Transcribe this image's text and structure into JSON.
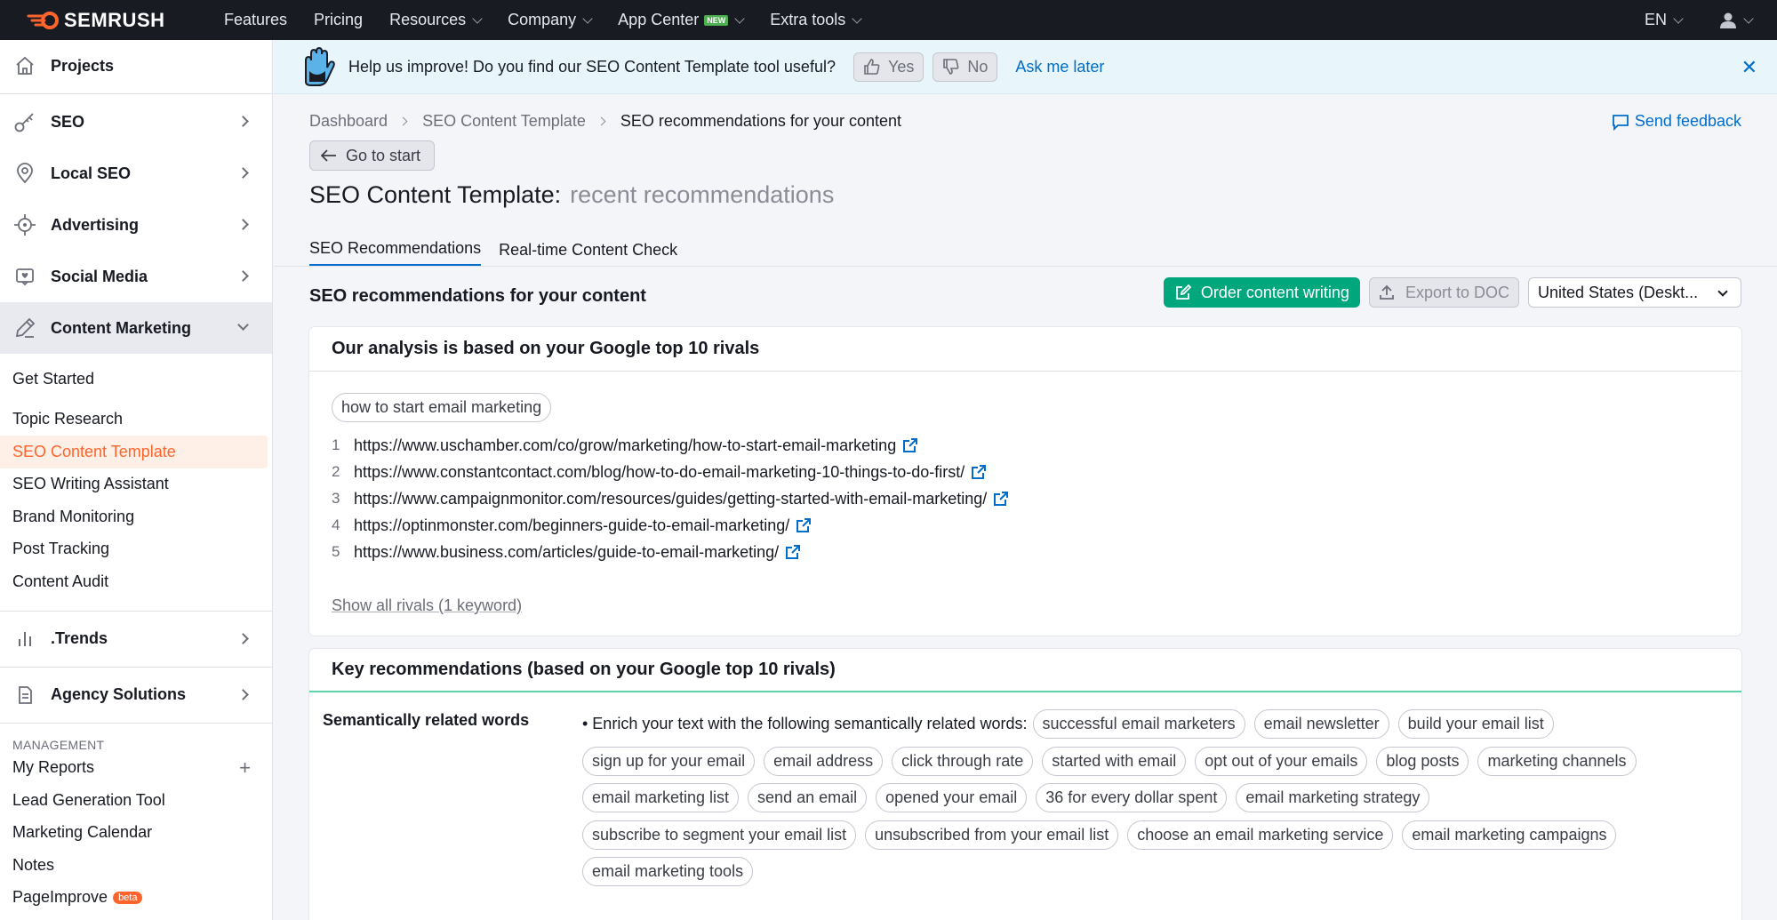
{
  "topbar": {
    "brand": "SEMRUSH",
    "nav": [
      {
        "label": "Features",
        "dropdown": false
      },
      {
        "label": "Pricing",
        "dropdown": false
      },
      {
        "label": "Resources",
        "dropdown": true
      },
      {
        "label": "Company",
        "dropdown": true
      },
      {
        "label": "App Center",
        "dropdown": true,
        "badge": "NEW"
      },
      {
        "label": "Extra tools",
        "dropdown": true
      }
    ],
    "language": "EN"
  },
  "sidebar": {
    "projects": "Projects",
    "seo": "SEO",
    "local_seo": "Local SEO",
    "advertising": "Advertising",
    "social_media": "Social Media",
    "content_marketing": "Content Marketing",
    "content_items": [
      "Get Started",
      "Topic Research",
      "SEO Content Template",
      "SEO Writing Assistant",
      "Brand Monitoring",
      "Post Tracking",
      "Content Audit"
    ],
    "trends": ".Trends",
    "agency": "Agency Solutions",
    "management_title": "MANAGEMENT",
    "management_items": [
      "My Reports",
      "Lead Generation Tool",
      "Marketing Calendar",
      "Notes",
      "PageImprove"
    ],
    "beta_badge": "beta"
  },
  "banner": {
    "text": "Help us improve! Do you find our SEO Content Template tool useful?",
    "yes": "Yes",
    "no": "No",
    "ask_later": "Ask me later"
  },
  "breadcrumbs": [
    "Dashboard",
    "SEO Content Template",
    "SEO recommendations for your content"
  ],
  "send_feedback": "Send feedback",
  "go_to_start": "Go to start",
  "page_title": "SEO Content Template:",
  "page_subtitle": "recent recommendations",
  "tabs": [
    "SEO Recommendations",
    "Real-time Content Check"
  ],
  "section_heading": "SEO recommendations for your content",
  "actions": {
    "order": "Order content writing",
    "export": "Export to DOC",
    "location": "United States (Deskt..."
  },
  "analysis": {
    "title": "Our analysis is based on your Google top 10 rivals",
    "keyword": "how to start email marketing",
    "rivals": [
      "https://www.uschamber.com/co/grow/marketing/how-to-start-email-marketing",
      "https://www.constantcontact.com/blog/how-to-do-email-marketing-10-things-to-do-first/",
      "https://www.campaignmonitor.com/resources/guides/getting-started-with-email-marketing/",
      "https://optinmonster.com/beginners-guide-to-email-marketing/",
      "https://www.business.com/articles/guide-to-email-marketing/"
    ],
    "show_all": "Show all rivals (1 keyword)"
  },
  "key_recs": {
    "title": "Key recommendations (based on your Google top 10 rivals)",
    "semantic_label": "Semantically related words",
    "lead": "• Enrich your text with the following semantically related words:",
    "words": [
      "successful email marketers",
      "email newsletter",
      "build your email list",
      "sign up for your email",
      "email address",
      "click through rate",
      "started with email",
      "opt out of your emails",
      "blog posts",
      "marketing channels",
      "email marketing list",
      "send an email",
      "opened your email",
      "36 for every dollar spent",
      "email marketing strategy",
      "subscribe to segment your email list",
      "unsubscribed from your email list",
      "choose an email marketing service",
      "email marketing campaigns",
      "email marketing tools"
    ]
  },
  "colors": {
    "topbar": "#191b23",
    "brand_orange": "#ff642d",
    "link_blue": "#006dca",
    "green": "#00a77d"
  }
}
